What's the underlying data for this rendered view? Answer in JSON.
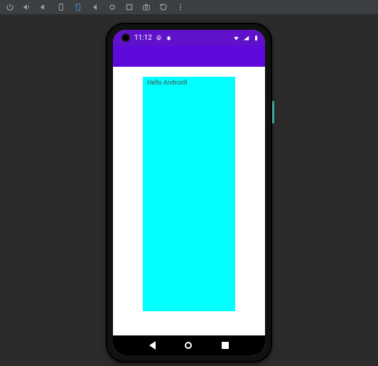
{
  "toolbar": {
    "icons": [
      "power",
      "volume-up",
      "volume-down",
      "rotate-left",
      "rotate-right",
      "back",
      "home",
      "overview",
      "screenshot",
      "reload",
      "more"
    ]
  },
  "status": {
    "time": "11:12",
    "left_icons": [
      "gear",
      "bug"
    ],
    "right_icons": [
      "wifi",
      "signal",
      "battery"
    ]
  },
  "colors": {
    "status_bar": "#5f12c9",
    "action_bar": "#6009dd",
    "box": "#00ffff"
  },
  "app": {
    "greeting": "Hello Android!"
  },
  "nav": {
    "back": "◀",
    "home": "●",
    "recent": "■"
  }
}
